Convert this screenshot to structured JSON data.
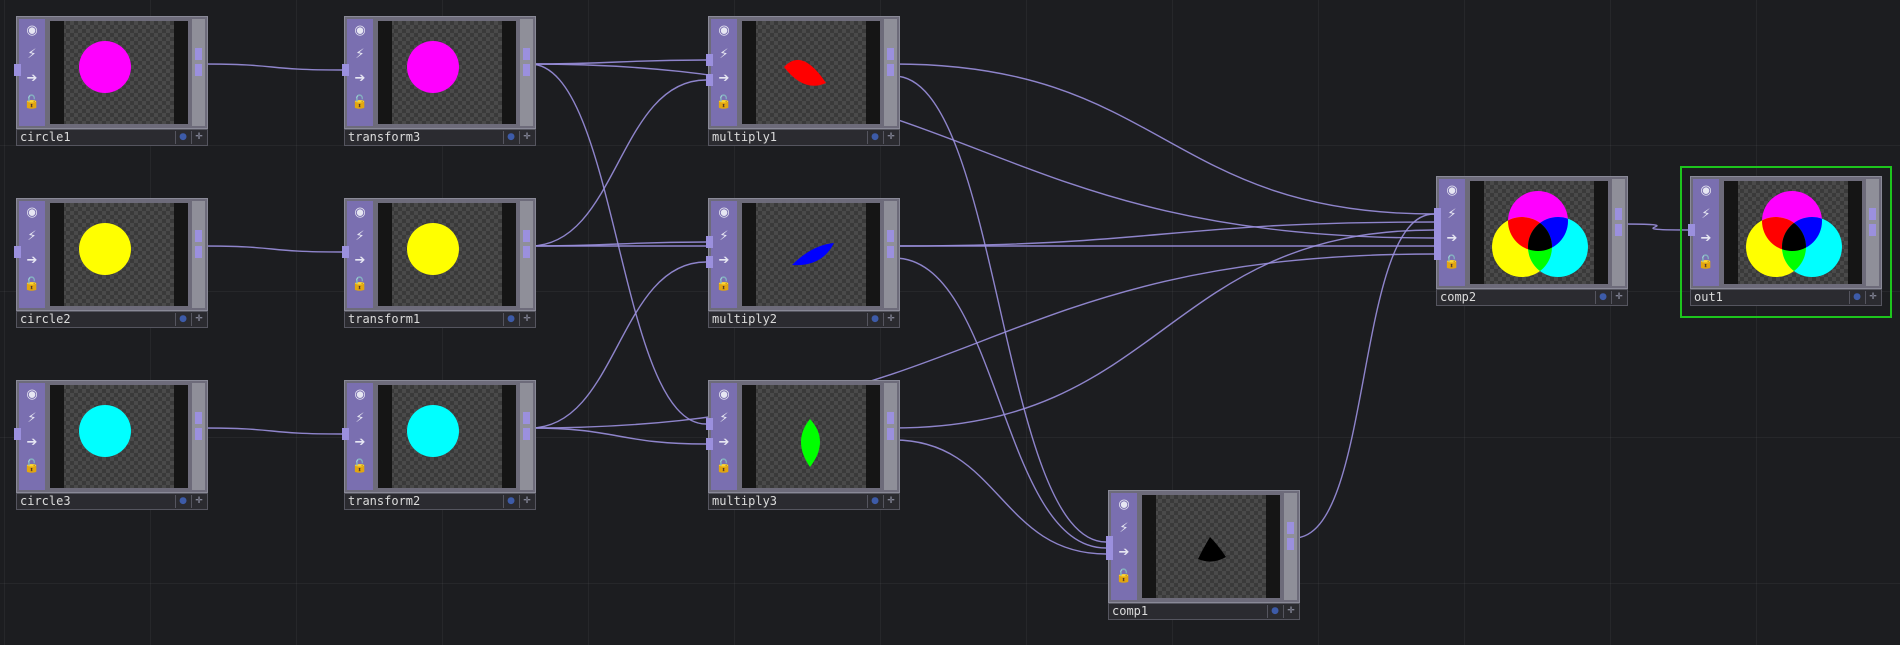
{
  "colors": {
    "background": "#1c1d20",
    "wire": "#9b90de",
    "node_strip": "#7a6fb0",
    "selected_outline": "#1dc51d"
  },
  "node_buttons": [
    "viewer-toggle-icon",
    "cook-icon",
    "bypass-arrow-icon",
    "lock-icon"
  ],
  "node_button_glyphs": [
    "◉",
    "⚡",
    "➔",
    "🔓"
  ],
  "label_buttons": {
    "viewer_glyph": "●",
    "pin_glyph": "✛"
  },
  "nodes": [
    {
      "id": "circle1",
      "label": "circle1",
      "preview": "circle-magenta"
    },
    {
      "id": "circle2",
      "label": "circle2",
      "preview": "circle-yellow"
    },
    {
      "id": "circle3",
      "label": "circle3",
      "preview": "circle-cyan"
    },
    {
      "id": "transform3",
      "label": "transform3",
      "preview": "circle-magenta"
    },
    {
      "id": "transform1",
      "label": "transform1",
      "preview": "circle-yellow"
    },
    {
      "id": "transform2",
      "label": "transform2",
      "preview": "circle-cyan"
    },
    {
      "id": "multiply1",
      "label": "multiply1",
      "preview": "lens-red"
    },
    {
      "id": "multiply2",
      "label": "multiply2",
      "preview": "lens-blue"
    },
    {
      "id": "multiply3",
      "label": "multiply3",
      "preview": "lens-green"
    },
    {
      "id": "comp1",
      "label": "comp1",
      "preview": "triangle-black"
    },
    {
      "id": "comp2",
      "label": "comp2",
      "preview": "venn"
    },
    {
      "id": "out1",
      "label": "out1",
      "preview": "venn",
      "selected": true
    }
  ],
  "preview_colors": {
    "magenta": "#ff00ff",
    "yellow": "#ffff00",
    "cyan": "#00ffff",
    "red": "#ff0000",
    "blue": "#0000ff",
    "green": "#00ff00",
    "black": "#000000"
  },
  "connections": [
    [
      "circle1",
      "transform3"
    ],
    [
      "circle2",
      "transform1"
    ],
    [
      "circle3",
      "transform2"
    ],
    [
      "transform3",
      "multiply1"
    ],
    [
      "transform1",
      "multiply1"
    ],
    [
      "transform1",
      "multiply2"
    ],
    [
      "transform2",
      "multiply2"
    ],
    [
      "transform3",
      "multiply3"
    ],
    [
      "transform2",
      "multiply3"
    ],
    [
      "multiply1",
      "comp2"
    ],
    [
      "multiply2",
      "comp2"
    ],
    [
      "multiply3",
      "comp2"
    ],
    [
      "transform3",
      "comp2"
    ],
    [
      "transform1",
      "comp2"
    ],
    [
      "transform2",
      "comp2"
    ],
    [
      "multiply1",
      "comp1"
    ],
    [
      "multiply2",
      "comp1"
    ],
    [
      "multiply3",
      "comp1"
    ],
    [
      "comp1",
      "comp2"
    ],
    [
      "comp2",
      "out1"
    ]
  ]
}
